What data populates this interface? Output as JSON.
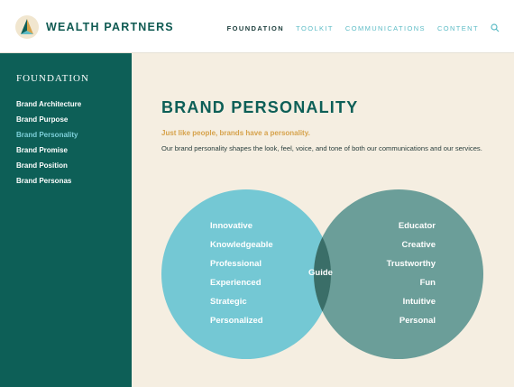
{
  "header": {
    "brand": "WEALTH PARTNERS",
    "nav": [
      "FOUNDATION",
      "TOOLKIT",
      "COMMUNICATIONS",
      "CONTENT"
    ],
    "active_nav": "FOUNDATION",
    "search_icon": "search-icon"
  },
  "sidebar": {
    "title": "FOUNDATION",
    "items": [
      {
        "label": "Brand Architecture"
      },
      {
        "label": "Brand Purpose"
      },
      {
        "label": "Brand Personality"
      },
      {
        "label": "Brand Promise"
      },
      {
        "label": "Brand Position"
      },
      {
        "label": "Brand Personas"
      }
    ],
    "active_item": "Brand Personality"
  },
  "main": {
    "title": "BRAND PERSONALITY",
    "tagline": "Just like people, brands have a personality.",
    "description": "Our brand personality shapes the look, feel, voice, and tone of both our communications and our services.",
    "venn": {
      "left": [
        "Innovative",
        "Knowledgeable",
        "Professional",
        "Experienced",
        "Strategic",
        "Personalized"
      ],
      "right": [
        "Educator",
        "Creative",
        "Trustworthy",
        "Fun",
        "Intuitive",
        "Personal"
      ],
      "center": "Guide"
    }
  },
  "colors": {
    "primary": "#0d5f57",
    "accent": "#5dbcc6",
    "gold": "#d6a24b",
    "background": "#f5eee1",
    "venn_left": "#74c8d4",
    "venn_right": "#6b9e99",
    "venn_overlap": "#3a6e68"
  }
}
